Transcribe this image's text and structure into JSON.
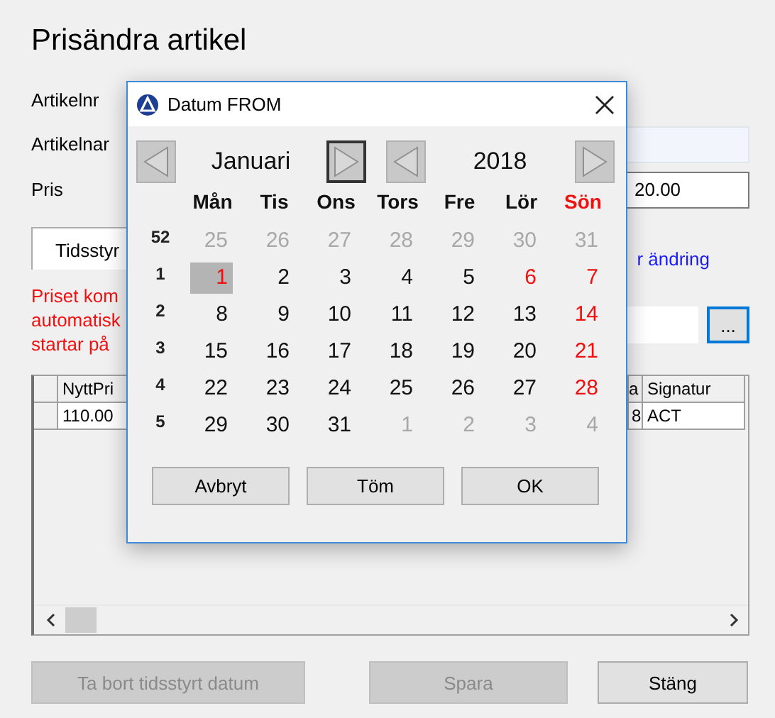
{
  "window": {
    "title": "Prisändra artikel"
  },
  "labels": [
    "Artikelnr",
    "Artikelnar",
    "Pris"
  ],
  "price_field": {
    "value": "20.00"
  },
  "tab": {
    "label": "Tidsstyr",
    "selected": true
  },
  "link": "r ändring",
  "notice": [
    "Priset kom",
    "automatisk",
    "startar på"
  ],
  "date_button": "...",
  "table": {
    "columns": [
      "NyttPri",
      "a",
      "Signatur"
    ],
    "rows": [
      [
        "110.00",
        "8",
        "ACT"
      ]
    ]
  },
  "buttons": [
    {
      "label": "Ta bort tidsstyrt datum",
      "disabled": true
    },
    {
      "label": "Spara",
      "disabled": true
    },
    {
      "label": "Stäng",
      "disabled": false
    }
  ],
  "dialog": {
    "title": "Datum FROM",
    "month": "Januari",
    "year": "2018",
    "month_nav": {
      "prev_focused": false,
      "next_focused": true
    },
    "year_nav": {
      "prev_focused": false,
      "next_focused": false
    },
    "weekdays": [
      {
        "label": "Mån",
        "holiday": false
      },
      {
        "label": "Tis",
        "holiday": false
      },
      {
        "label": "Ons",
        "holiday": false
      },
      {
        "label": "Tors",
        "holiday": false
      },
      {
        "label": "Fre",
        "holiday": false
      },
      {
        "label": "Lör",
        "holiday": false
      },
      {
        "label": "Sön",
        "holiday": true
      }
    ],
    "weeks": [
      {
        "week": "52",
        "days": [
          {
            "day": "25",
            "kind": "other"
          },
          {
            "day": "26",
            "kind": "other"
          },
          {
            "day": "27",
            "kind": "other"
          },
          {
            "day": "28",
            "kind": "other"
          },
          {
            "day": "29",
            "kind": "other"
          },
          {
            "day": "30",
            "kind": "other"
          },
          {
            "day": "31",
            "kind": "other"
          }
        ]
      },
      {
        "week": "1",
        "days": [
          {
            "day": "1",
            "kind": "holiday",
            "selected": true
          },
          {
            "day": "2",
            "kind": "normal"
          },
          {
            "day": "3",
            "kind": "normal"
          },
          {
            "day": "4",
            "kind": "normal"
          },
          {
            "day": "5",
            "kind": "normal"
          },
          {
            "day": "6",
            "kind": "holiday"
          },
          {
            "day": "7",
            "kind": "holiday"
          }
        ]
      },
      {
        "week": "2",
        "days": [
          {
            "day": "8",
            "kind": "normal"
          },
          {
            "day": "9",
            "kind": "normal"
          },
          {
            "day": "10",
            "kind": "normal"
          },
          {
            "day": "11",
            "kind": "normal"
          },
          {
            "day": "12",
            "kind": "normal"
          },
          {
            "day": "13",
            "kind": "normal"
          },
          {
            "day": "14",
            "kind": "holiday"
          }
        ]
      },
      {
        "week": "3",
        "days": [
          {
            "day": "15",
            "kind": "normal"
          },
          {
            "day": "16",
            "kind": "normal"
          },
          {
            "day": "17",
            "kind": "normal"
          },
          {
            "day": "18",
            "kind": "normal"
          },
          {
            "day": "19",
            "kind": "normal"
          },
          {
            "day": "20",
            "kind": "normal"
          },
          {
            "day": "21",
            "kind": "holiday"
          }
        ]
      },
      {
        "week": "4",
        "days": [
          {
            "day": "22",
            "kind": "normal"
          },
          {
            "day": "23",
            "kind": "normal"
          },
          {
            "day": "24",
            "kind": "normal"
          },
          {
            "day": "25",
            "kind": "normal"
          },
          {
            "day": "26",
            "kind": "normal"
          },
          {
            "day": "27",
            "kind": "normal"
          },
          {
            "day": "28",
            "kind": "holiday"
          }
        ]
      },
      {
        "week": "5",
        "days": [
          {
            "day": "29",
            "kind": "normal"
          },
          {
            "day": "30",
            "kind": "normal"
          },
          {
            "day": "31",
            "kind": "normal"
          },
          {
            "day": "1",
            "kind": "other"
          },
          {
            "day": "2",
            "kind": "other"
          },
          {
            "day": "3",
            "kind": "other"
          },
          {
            "day": "4",
            "kind": "other"
          }
        ]
      }
    ],
    "buttons": [
      "Avbryt",
      "Töm",
      "OK"
    ]
  }
}
